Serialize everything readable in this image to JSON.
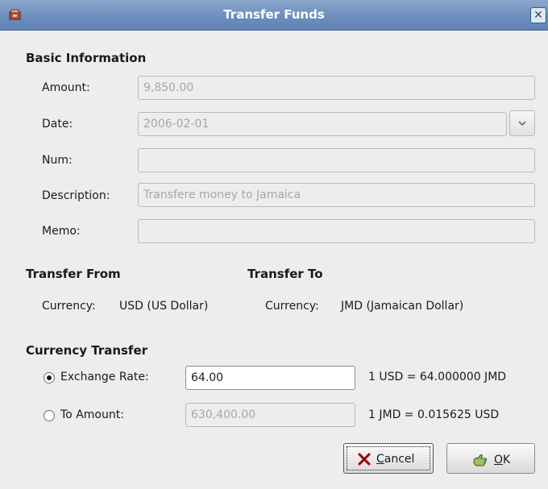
{
  "window": {
    "title": "Transfer Funds",
    "close_glyph": "✕"
  },
  "basic": {
    "heading": "Basic Information",
    "amount_label": "Amount:",
    "amount_value": "9,850.00",
    "date_label": "Date:",
    "date_value": "2006-02-01",
    "num_label": "Num:",
    "num_value": "",
    "description_label": "Description:",
    "description_value": "Transfere money to Jamaica",
    "memo_label": "Memo:",
    "memo_value": ""
  },
  "transfer_from": {
    "heading": "Transfer From",
    "currency_label": "Currency:",
    "currency_value": "USD (US Dollar)"
  },
  "transfer_to": {
    "heading": "Transfer To",
    "currency_label": "Currency:",
    "currency_value": "JMD (Jamaican Dollar)"
  },
  "currency_transfer": {
    "heading": "Currency Transfer",
    "exchange_rate_label": "Exchange Rate:",
    "exchange_rate_value": "64.00",
    "exchange_rate_selected": true,
    "exchange_rate_note": "1 USD = 64.000000 JMD",
    "to_amount_label": "To Amount:",
    "to_amount_value": "630,400.00",
    "to_amount_selected": false,
    "to_amount_note": "1 JMD = 0.015625 USD"
  },
  "buttons": {
    "cancel_mnemonic": "C",
    "cancel_rest": "ancel",
    "ok_mnemonic": "O",
    "ok_rest": "K"
  },
  "icons": {
    "app": "gnucash-icon",
    "close": "close-icon",
    "dropdown": "chevron-down-icon",
    "cancel": "red-x-icon",
    "ok": "ok-hand-icon"
  },
  "colors": {
    "titlebar": "#6d8fbd",
    "disabled_text": "#a6a6a6",
    "dialog_bg": "#ededed"
  }
}
